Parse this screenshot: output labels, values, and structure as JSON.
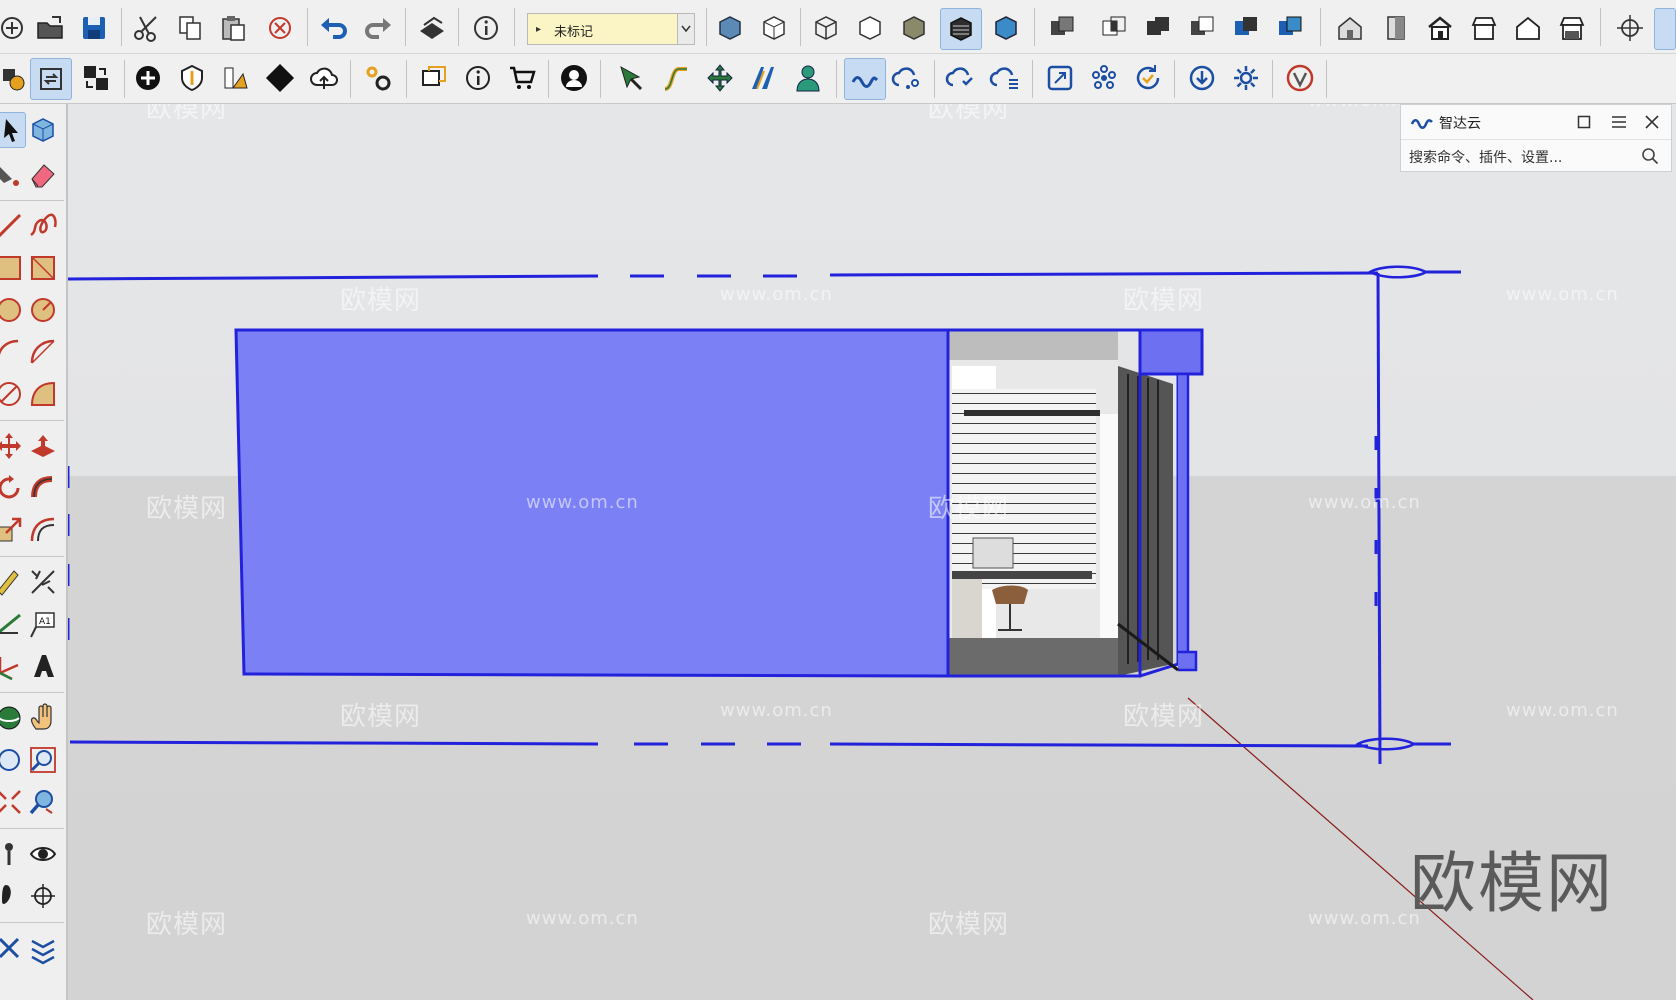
{
  "toolbar": {
    "tag_dropdown": {
      "value": "未标记"
    }
  },
  "panel": {
    "title": "智达云",
    "search_placeholder": "搜索命令、插件、设置..."
  },
  "watermarks": {
    "logo": "欧模网",
    "url": "www.om.cn",
    "big": "欧模网"
  },
  "colors": {
    "selection": "#2222dd",
    "selected_face": "#7b80f4",
    "axis_red": "#8a1a1a"
  }
}
